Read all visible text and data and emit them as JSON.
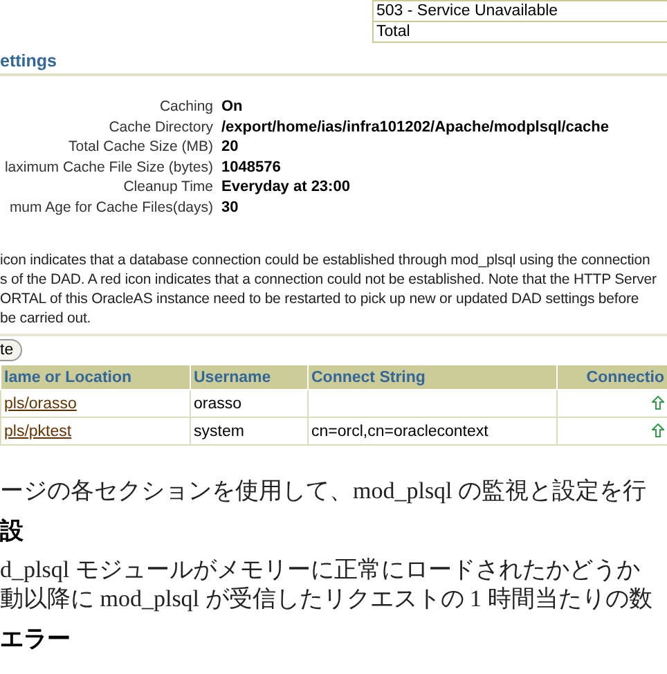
{
  "status_table": {
    "rows": [
      "503 - Service Unavailable",
      "Total"
    ]
  },
  "settings": {
    "title": "ettings",
    "items": [
      {
        "label": "Caching",
        "value": "On"
      },
      {
        "label": "Cache Directory",
        "value": "/export/home/ias/infra101202/Apache/modplsql/cache"
      },
      {
        "label": "Total Cache Size (MB)",
        "value": "20"
      },
      {
        "label": "laximum Cache File Size (bytes)",
        "value": "1048576"
      },
      {
        "label": "Cleanup Time",
        "value": "Everyday at 23:00"
      },
      {
        "label": "mum Age for Cache Files(days)",
        "value": "30"
      }
    ]
  },
  "note_lines": [
    "icon indicates that a database connection could be established through mod_plsql using the connection",
    "s of the DAD. A red icon indicates that a connection could not be established. Note that the HTTP Server",
    "ORTAL of this OracleAS instance need to be restarted to pick up new or updated DAD settings before",
    "be carried out."
  ],
  "button": "te",
  "dad_table": {
    "columns": [
      "lame or Location",
      "Username",
      "Connect String",
      "Connectio"
    ],
    "rows": [
      {
        "name": "pls/orasso",
        "username": "orasso",
        "connect_string": "",
        "connection_ok": true
      },
      {
        "name": "pls/pktest",
        "username": "system",
        "connect_string": "cn=orcl,cn=oraclecontext",
        "connection_ok": true
      }
    ]
  },
  "doc": [
    {
      "kind": "para",
      "lines": [
        "ージの各セクションを使用して、mod_plsql の監視と設定を行"
      ]
    },
    {
      "kind": "heading",
      "text": "設"
    },
    {
      "kind": "para",
      "lines": [
        "d_plsql モジュールがメモリーに正常にロードされたかどうか",
        "動以降に mod_plsql が受信したリクエストの 1 時間当たりの数"
      ]
    },
    {
      "kind": "heading",
      "text": "エラー"
    }
  ]
}
